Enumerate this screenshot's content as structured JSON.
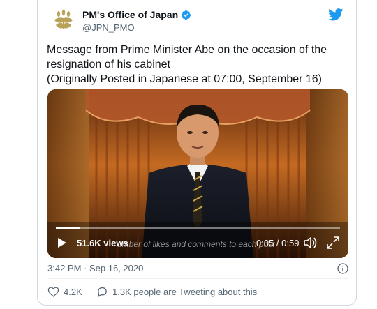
{
  "account": {
    "display_name": "PM's Office of Japan",
    "handle": "@JPN_PMO"
  },
  "tweet": {
    "lines": [
      "Message from Prime Minister Abe on the occasion of the",
      "resignation of his cabinet",
      "(Originally Posted in Japanese at 07:00, September 16)"
    ]
  },
  "video": {
    "views": "51.6K views",
    "overlay_text": "umber of likes and comments to each post",
    "time": "0:05 / 0:59",
    "progress": 0.085
  },
  "meta": {
    "timestamp": "3:42 PM · Sep 16, 2020"
  },
  "actions": {
    "likes": "4.2K",
    "tweeting": "1.3K people are Tweeting about this"
  },
  "colors": {
    "twitter_blue": "#1d9bf0",
    "verified": "#1d9bf0",
    "like_red": "#f91880",
    "emblem_gold": "#b8a25a"
  },
  "icons": [
    "paulownia-emblem-icon",
    "verified-icon",
    "twitter-bird-icon",
    "play-icon",
    "volume-icon",
    "expand-icon",
    "info-icon",
    "heart-icon",
    "chat-icon"
  ]
}
